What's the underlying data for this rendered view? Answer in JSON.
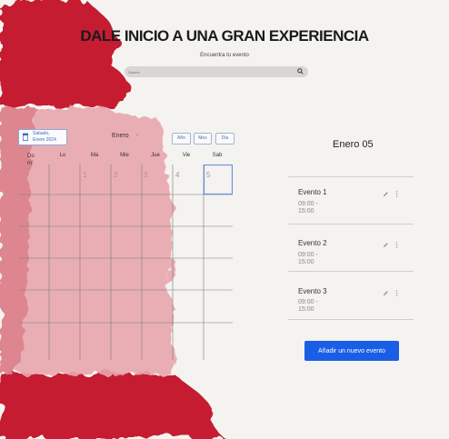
{
  "hero": {
    "title": "DALE INICIO A UNA GRAN EXPERIENCIA",
    "subtitle": "Encuentra tu evento",
    "search_placeholder": "Search"
  },
  "calendar": {
    "selected_date_line1": "Sabado,",
    "selected_date_line2": "Enero 2024",
    "month": "Enero",
    "month_chevron": "›",
    "views": [
      "Año",
      "Mes",
      "Dia"
    ],
    "weekdays": [
      "Do m",
      "Lu",
      "Ma",
      "Mie",
      "Jue",
      "Vie",
      "Sab"
    ],
    "days": [
      "1",
      "2",
      "3",
      "4",
      "5"
    ],
    "selected_day": "5"
  },
  "panel": {
    "title": "Enero 05",
    "events": [
      {
        "name": "Evento 1",
        "time_start": "09:00 -",
        "time_end": "15:00"
      },
      {
        "name": "Evento 2",
        "time_start": "09:00 -",
        "time_end": "15:00"
      },
      {
        "name": "Evento 3",
        "time_start": "09:00 -",
        "time_end": "15:00"
      }
    ],
    "add_button": "Añadir un nuevo evento"
  },
  "colors": {
    "accent": "#1a5ee6",
    "paint_red": "#c51d32",
    "selected_day_border": "#6b8fd6"
  },
  "icons": [
    "search-icon",
    "calendar-icon",
    "pencil-icon",
    "more-vertical-icon"
  ]
}
